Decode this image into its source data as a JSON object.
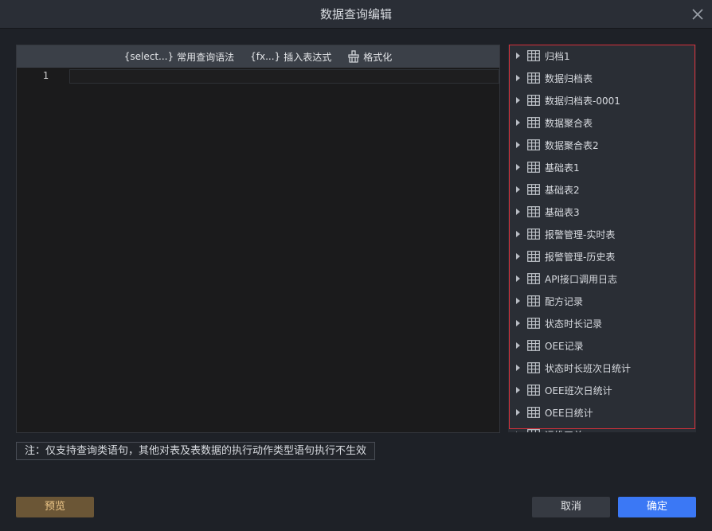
{
  "dialog": {
    "title": "数据查询编辑"
  },
  "toolbar": {
    "select_code": "{select...}",
    "select_label": "常用查询语法",
    "fx_code": "{fx...}",
    "fx_label": "插入表达式",
    "format_label": "格式化"
  },
  "editor": {
    "line_number": "1"
  },
  "tables": [
    "归档1",
    "数据归档表",
    "数据归档表-0001",
    "数据聚合表",
    "数据聚合表2",
    "基础表1",
    "基础表2",
    "基础表3",
    "报警管理-实时表",
    "报警管理-历史表",
    "API接口调用日志",
    "配方记录",
    "状态时长记录",
    "OEE记录",
    "状态时长班次日统计",
    "OEE班次日统计",
    "OEE日统计",
    "运维工单"
  ],
  "note": "注：仅支持查询类语句，其他对表及表数据的执行动作类型语句执行不生效",
  "buttons": {
    "preview": "预览",
    "cancel": "取消",
    "ok": "确定"
  },
  "colors": {
    "accent": "#3b78f5",
    "highlight_border": "#d6313a",
    "preview_bg": "#6b5636"
  },
  "icons": {
    "close": "close-icon",
    "format": "format-brush-icon",
    "table": "table-grid-icon",
    "expand": "caret-right-icon"
  }
}
